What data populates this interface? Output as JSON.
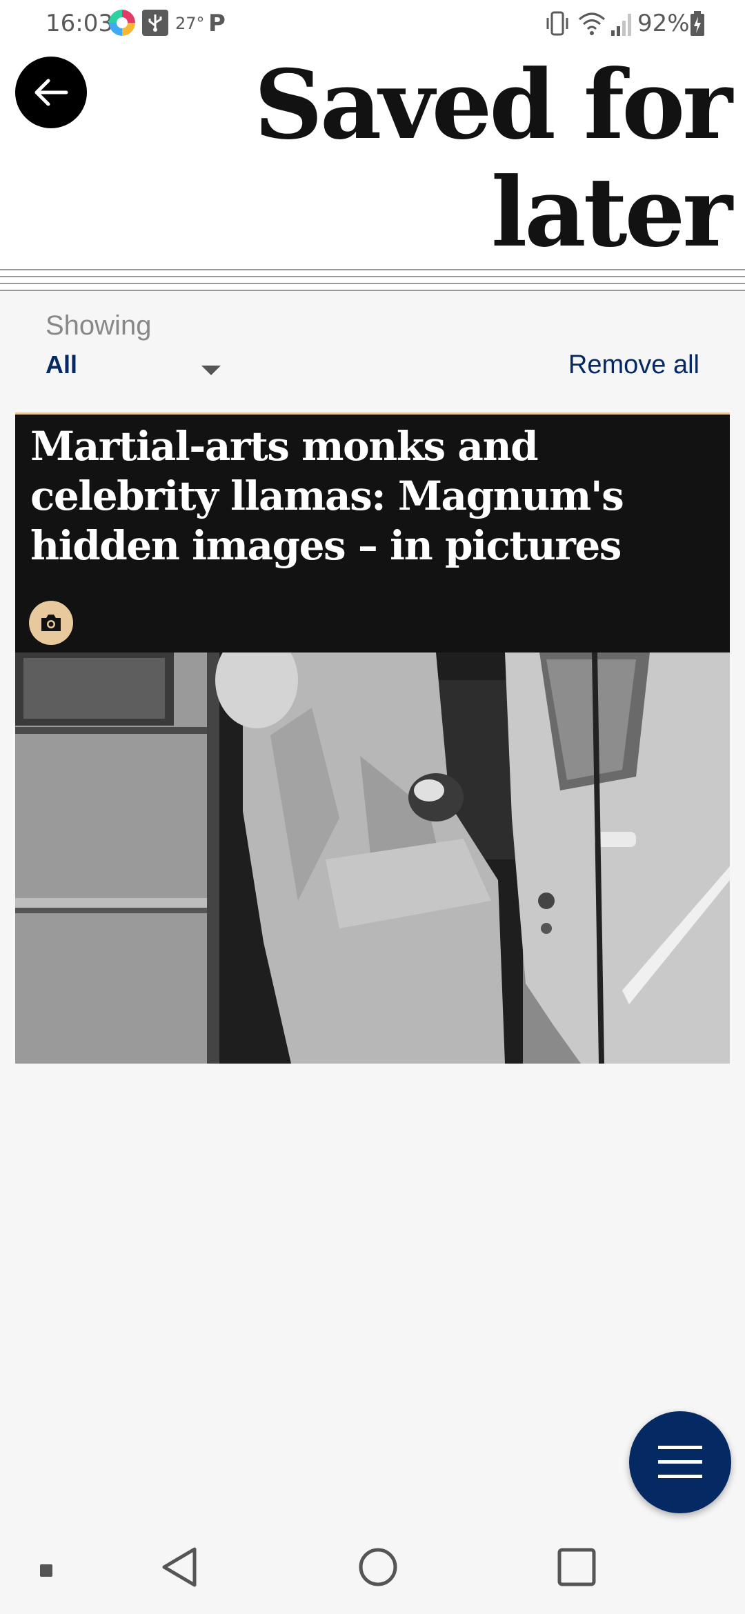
{
  "status_bar": {
    "time": "16:03",
    "temperature": "27°",
    "parking_app_letter": "P",
    "battery_percent": "92%"
  },
  "header": {
    "title": "Saved for later"
  },
  "filter": {
    "showing_label": "Showing",
    "selected_value": "All",
    "remove_all_label": "Remove all"
  },
  "saved_items": [
    {
      "headline": "Martial-arts monks and celebrity llamas: Magnum's hidden images – in pictures",
      "media_type_icon": "camera-icon"
    }
  ],
  "colors": {
    "brand_navy": "#052962",
    "card_background": "#121212",
    "camera_badge": "#e8c99e"
  }
}
